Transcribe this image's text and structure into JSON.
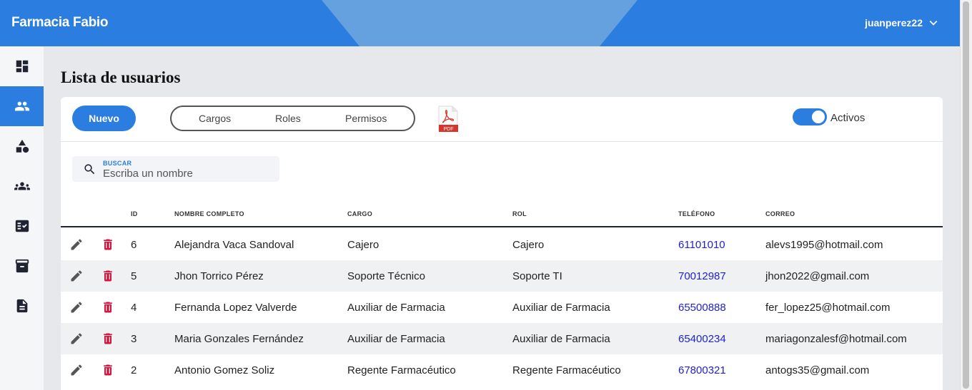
{
  "app": {
    "brand": "Farmacia Fabio",
    "user": "juanperez22"
  },
  "sidebar": {
    "items": [
      {
        "name": "dashboard-icon"
      },
      {
        "name": "users-icon",
        "active": true
      },
      {
        "name": "categories-icon"
      },
      {
        "name": "groups-icon"
      },
      {
        "name": "checklist-icon"
      },
      {
        "name": "archive-icon"
      },
      {
        "name": "document-icon"
      }
    ]
  },
  "page": {
    "title": "Lista de usuarios"
  },
  "toolbar": {
    "new_label": "Nuevo",
    "tabs": [
      "Cargos",
      "Roles",
      "Permisos"
    ],
    "pdf_label": "PDF",
    "toggle_label": "Activos"
  },
  "search": {
    "label": "BUSCAR",
    "placeholder": "Escriba un nombre"
  },
  "table": {
    "headers": [
      "ID",
      "NOMBRE COMPLETO",
      "CARGO",
      "ROL",
      "TELÉFONO",
      "CORREO"
    ],
    "rows": [
      {
        "id": "6",
        "name": "Alejandra Vaca Sandoval",
        "cargo": "Cajero",
        "rol": "Cajero",
        "phone": "61101010",
        "email": "alevs1995@hotmail.com"
      },
      {
        "id": "5",
        "name": "Jhon Torrico Pérez",
        "cargo": "Soporte Técnico",
        "rol": "Soporte TI",
        "phone": "70012987",
        "email": "jhon2022@gmail.com"
      },
      {
        "id": "4",
        "name": "Fernanda Lopez Valverde",
        "cargo": "Auxiliar de Farmacia",
        "rol": "Auxiliar de Farmacia",
        "phone": "65500888",
        "email": "fer_lopez25@hotmail.com"
      },
      {
        "id": "3",
        "name": "Maria Gonzales Fernández",
        "cargo": "Auxiliar de Farmacia",
        "rol": "Auxiliar de Farmacia",
        "phone": "65400234",
        "email": "mariagonzalesf@hotmail.com"
      },
      {
        "id": "2",
        "name": "Antonio Gomez Soliz",
        "cargo": "Regente Farmacéutico",
        "rol": "Regente Farmacéutico",
        "phone": "67800321",
        "email": "antogs35@gmail.com"
      }
    ]
  },
  "colors": {
    "primary": "#2b7de0",
    "danger": "#d6143c",
    "phone_link": "#2222c8"
  }
}
